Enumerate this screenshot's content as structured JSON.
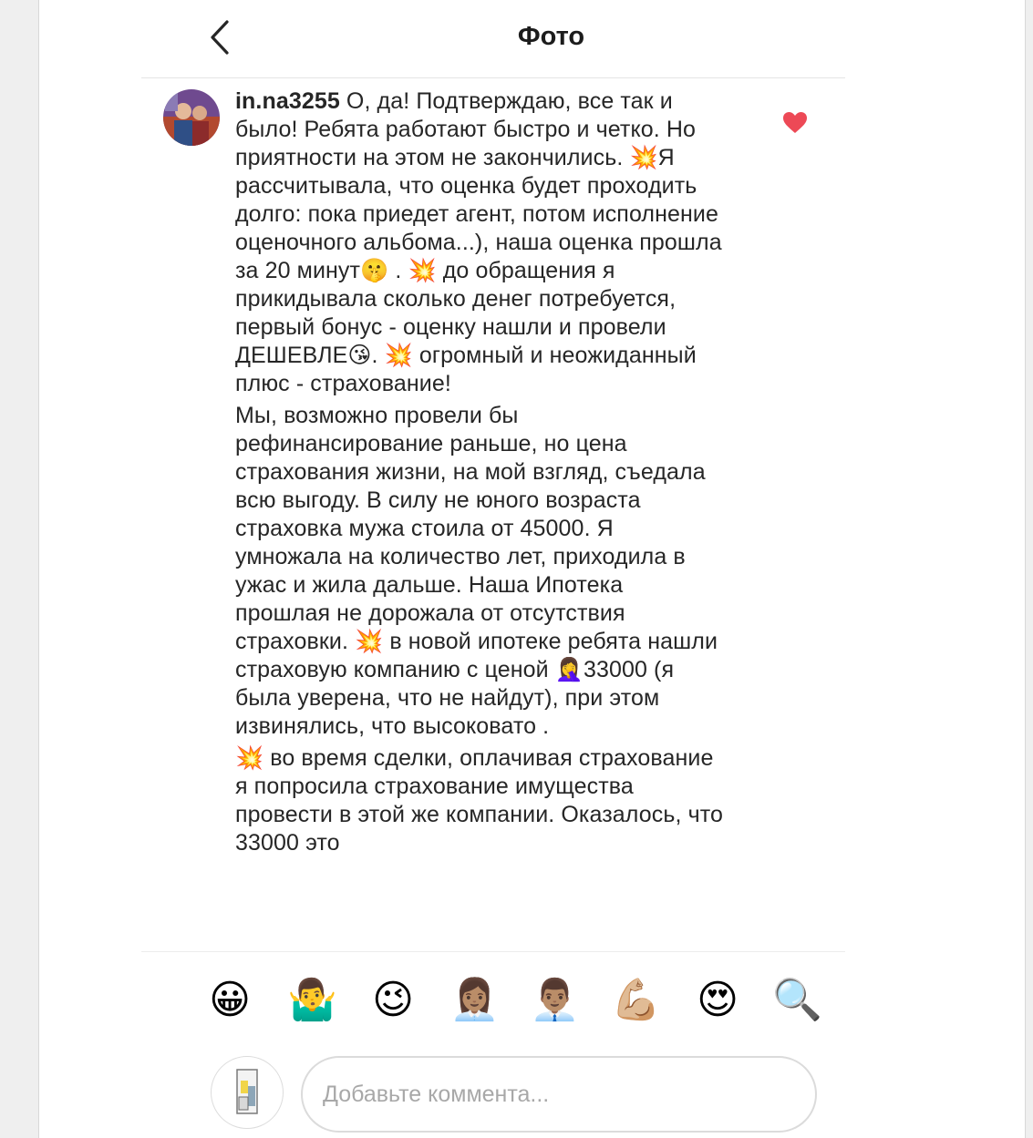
{
  "header": {
    "title": "Фото"
  },
  "comment": {
    "username": "in.na3255",
    "paragraphs": [
      " О, да! Подтверждаю, все так и было! Ребята работают быстро и четко. Но приятности на этом не закончились. 💥Я рассчитывала, что оценка будет проходить долго: пока приедет агент, потом исполнение оценочного альбома...), наша оценка прошла за 20 минут🤫 . 💥 до обращения я прикидывала сколько денег потребуется, первый бонус - оценку нашли и провели ДЕШЕВЛЕ😘. 💥 огромный и неожиданный плюс - страхование!",
      "Мы, возможно провели бы рефинансирование раньше, но цена страхования жизни, на мой взгляд, съедала всю выгоду. В силу не юного возраста страховка мужа стоила от 45000. Я умножала на количество лет, приходила в ужас и жила дальше. Наша Ипотека прошлая не дорожала от отсутствия страховки. 💥 в новой ипотеке ребята нашли страховую компанию с ценой 🤦‍♀️33000 (я была уверена, что не найдут), при этом извинялись, что высоковато .",
      "💥 во время сделки, оплачивая страхование я попросила страхование имущества провести в этой же компании. Оказалось, что 33000 это"
    ],
    "liked": true
  },
  "emoji_bar": {
    "items": [
      {
        "name": "grinning-face-emoji",
        "glyph": "😀"
      },
      {
        "name": "man-shrugging-emoji",
        "glyph": "🤷‍♂️"
      },
      {
        "name": "winking-face-emoji",
        "glyph": "😉"
      },
      {
        "name": "woman-office-worker-emoji",
        "glyph": "👩🏽‍💼"
      },
      {
        "name": "man-office-worker-emoji",
        "glyph": "👨🏽‍💼"
      },
      {
        "name": "flexed-biceps-emoji",
        "glyph": "💪🏼"
      },
      {
        "name": "heart-eyes-emoji",
        "glyph": "😍"
      },
      {
        "name": "magnifying-glass-emoji",
        "glyph": "🔍"
      }
    ]
  },
  "input": {
    "placeholder": "Добавьте коммента..."
  },
  "colors": {
    "like": "#ed4956",
    "text": "#262626",
    "placeholder": "#a8a8a8"
  }
}
